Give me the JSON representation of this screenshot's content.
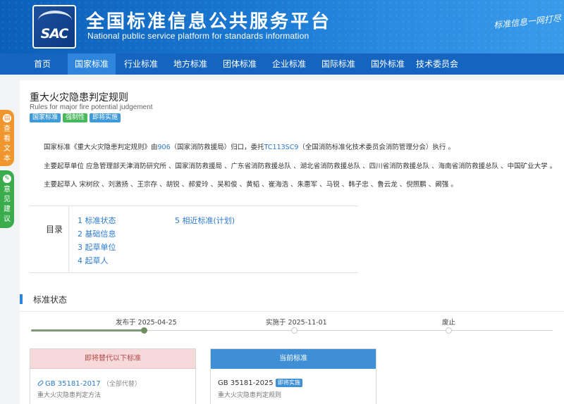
{
  "header": {
    "logo_text": "SAC",
    "title": "全国标准信息公共服务平台",
    "subtitle": "National public service platform  for standards information",
    "slogan": "标准信息一网打尽"
  },
  "nav": {
    "items": [
      {
        "label": "首页",
        "active": false
      },
      {
        "label": "国家标准",
        "active": true
      },
      {
        "label": "行业标准",
        "active": false
      },
      {
        "label": "地方标准",
        "active": false
      },
      {
        "label": "团体标准",
        "active": false
      },
      {
        "label": "企业标准",
        "active": false
      },
      {
        "label": "国际标准",
        "active": false
      },
      {
        "label": "国外标准",
        "active": false
      },
      {
        "label": "技术委员会",
        "active": false
      }
    ]
  },
  "side": {
    "view_text": [
      "查",
      "看",
      "文",
      "本"
    ],
    "feedback": [
      "意",
      "见",
      "建",
      "议"
    ]
  },
  "standard": {
    "title": "重大火灾隐患判定规则",
    "title_en": "Rules for major fire potential judgement",
    "badges": [
      "国家标准",
      "强制性",
      "即将实施"
    ],
    "intro_prefix": "国家标准《重大火灾隐患判定规则》由",
    "intro_dept_code": "906",
    "intro_middle": "（国家消防救援局）归口，委托",
    "intro_tc": "TC113SC9",
    "intro_suffix": "（全国消防标准化技术委员会消防管理分会）执行 。",
    "drafting_units": "主要起草单位 应急管理部天津消防研究所 、国家消防救援局 、广东省消防救援总队 、湖北省消防救援总队 、四川省消防救援总队 、海南省消防救援总队 、中国矿业大学 。",
    "drafters": "主要起草人 宋树欣 、刘激扬 、王宗存 、胡锐 、郝爱玲 、吴和俊 、黄韬 、崔海浩 、朱惠军 、马锐 、韩子忠 、鲁云龙 、倪照鹏 、阚强 。"
  },
  "toc": {
    "heading": "目录",
    "items": [
      "1  标准状态",
      "2  基础信息",
      "3  起草单位",
      "4  起草人",
      "5  相近标准(计划)"
    ]
  },
  "status": {
    "section_title": "标准状态",
    "timeline": [
      {
        "label": "发布于 2025-04-25",
        "done": true
      },
      {
        "label": "实施于 2025-11-01",
        "done": false
      },
      {
        "label": "废止",
        "done": false
      }
    ],
    "progress": 0.22
  },
  "cards": {
    "replace": {
      "header": "即将替代以下标准",
      "code": "GB 35181-2017",
      "note": "（全部代替）",
      "name": "重大火灾隐患判定方法"
    },
    "current": {
      "header": "当前标准",
      "code": "GB 35181-2025",
      "tag": "即将实施",
      "name": "重大火灾隐患判定规则"
    }
  },
  "colors": {
    "header_blue": "#1a78d2",
    "nav_blue": "#1565c0",
    "link_blue": "#2b7bd0",
    "float_orange": "#f0962e",
    "float_green": "#3aac4c"
  }
}
